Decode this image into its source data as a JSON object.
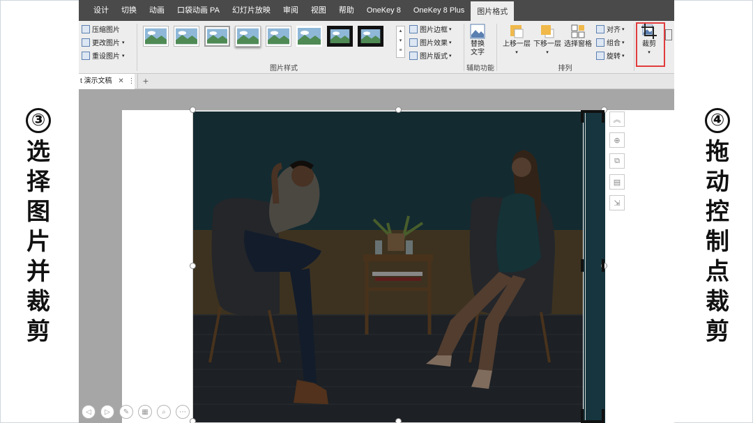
{
  "left_caption": {
    "step": "③",
    "chars": [
      "选",
      "择",
      "图",
      "片",
      "并",
      "裁",
      "剪"
    ]
  },
  "right_caption": {
    "step": "④",
    "chars": [
      "拖",
      "动",
      "控",
      "制",
      "点",
      "裁",
      "剪"
    ]
  },
  "tabs": [
    "设计",
    "切换",
    "动画",
    "口袋动画 PA",
    "幻灯片放映",
    "审阅",
    "视图",
    "帮助",
    "OneKey 8",
    "OneKey 8 Plus",
    "图片格式"
  ],
  "ribbon": {
    "adjust": {
      "compress": "压缩图片",
      "change": "更改图片",
      "reset": "重设图片"
    },
    "styles": {
      "label": "图片样式",
      "border": "图片边框",
      "effects": "图片效果",
      "layout": "图片版式"
    },
    "accessibility": {
      "label": "辅助功能",
      "alt_text": "替换\n文字"
    },
    "arrange": {
      "label": "排列",
      "forward": "上移一层",
      "backward": "下移一层",
      "selection_pane": "选择窗格",
      "align": "对齐",
      "group": "组合",
      "rotate": "旋转"
    },
    "size": {
      "crop": "裁剪"
    }
  },
  "doc_tab": {
    "title": "t 演示文稿"
  },
  "colors": {
    "titlebar": "#4a4a4a",
    "ribbon": "#ededed",
    "accent_red": "#e23b3b",
    "wall": "#1f4650"
  }
}
